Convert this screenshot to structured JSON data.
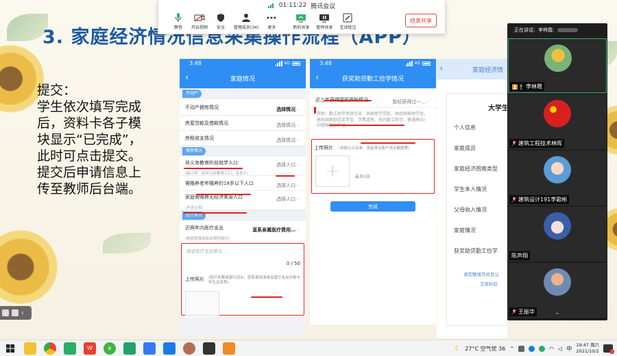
{
  "meeting": {
    "timer": "01:11:22",
    "app_name": "腾讯会议",
    "tools": [
      {
        "label": "静音",
        "icon": "microphone-icon"
      },
      {
        "label": "开启视频",
        "icon": "video-off-icon"
      },
      {
        "label": "安全",
        "icon": "shield-icon"
      },
      {
        "label": "管理成员(34)",
        "icon": "members-icon"
      },
      {
        "label": "更多",
        "icon": "more-icon"
      },
      {
        "label": "新的共享",
        "icon": "share-screen-icon"
      },
      {
        "label": "暂停共享",
        "icon": "pause-icon"
      },
      {
        "label": "互动批注",
        "icon": "annotate-icon"
      }
    ],
    "end_share": "结束共享"
  },
  "slide": {
    "title": "3. 家庭经济情况信息采集操作流程（APP）",
    "desc_lines": [
      "提交：",
      "学生依次填写完成",
      "后，资料卡各子模",
      "块显示“已完成”，",
      "此时可点击提交。",
      "提交后申请信息上",
      "传至教师后台端。"
    ]
  },
  "phone1": {
    "time": "3:48",
    "network": "4G",
    "title": "家庭情况",
    "sections": [
      {
        "tag": "不动产",
        "rows": [
          {
            "label": "不动产拥有情况",
            "value": "选择情况",
            "bold": true,
            "sub": ""
          },
          {
            "label": "房屋贷款及借款情况",
            "value": "选择情况",
            "bold": false,
            "sub": ""
          },
          {
            "label": "房租收支情况",
            "value": "选择情况",
            "bold": false,
            "sub": ""
          }
        ]
      },
      {
        "tag": "赡养情况",
        "rows": [
          {
            "label": "非义务教育阶段就学人口",
            "value": "选择人口",
            "bold": false,
            "sub": "(除小学、初中以外教学人口，含本人)"
          },
          {
            "label": "需赡养老年赡养的18岁以下人口",
            "value": "选择人口",
            "bold": false,
            "sub": ""
          },
          {
            "label": "家庭需赡养无经济来源人口",
            "value": "选择人口",
            "bold": false,
            "sub": "(不含父母)"
          }
        ]
      },
      {
        "tag": "医疗情况",
        "rows": [
          {
            "label": "近两年内医疗支出",
            "value": "直系亲属医疗费用…",
            "bold": true,
            "sub": "(除却医保及商业保险部分)"
          }
        ]
      }
    ],
    "textarea_placeholder": "描述医疗支出情况...",
    "counter": "0 / 50",
    "upload_label": "上传照片",
    "upload_hint": "(医疗发票或银行流水、医院费用清单及医疗支出对象与学生关系等)"
  },
  "phone2": {
    "time": "3:48",
    "network": "4G",
    "title": "获奖助贷勤工俭学情况",
    "row_label": "近三年获得国家资助情况",
    "row_value": "曾经获得过一…",
    "paragraph": "获助：勤工助学项目包含：国家助学贷款、高校国家助学金、高校国家励志奖学金、学费减免、校内勤工助学、普通高中/中职国家助学金。",
    "upload_label": "上传照片",
    "upload_hint": "(资助公示名单、资金来往账户流水截图等)",
    "upload_limit": "最多5张",
    "submit_label": "完成"
  },
  "window3": {
    "title": "家庭经济情",
    "card_title": "大学生",
    "items": [
      "个人信息",
      "家庭成员",
      "家庭经济困难类型",
      "学生本人情况",
      "父母收入情况",
      "家庭情况",
      "获奖助贷勤工俭学"
    ],
    "hint1": "请完整填写并且认",
    "hint2": "交资料后"
  },
  "participants": {
    "speaking_label": "正在讲话：李林霞;",
    "list": [
      {
        "name": "李林霞",
        "icon": "person-icon"
      },
      {
        "name": "建筑工程技术林晖",
        "icon": "mic-muted-icon"
      },
      {
        "name": "建筑设计191李歌彬",
        "icon": "mic-muted-icon"
      },
      {
        "name": "陈声翔",
        "icon": ""
      },
      {
        "name": "王振华",
        "icon": "mic-muted-icon"
      }
    ]
  },
  "taskbar": {
    "weather": "27°C 空气优 36",
    "ime": "中",
    "time": "19:47 周六",
    "date": "2021/10/2",
    "notifications": "2"
  }
}
